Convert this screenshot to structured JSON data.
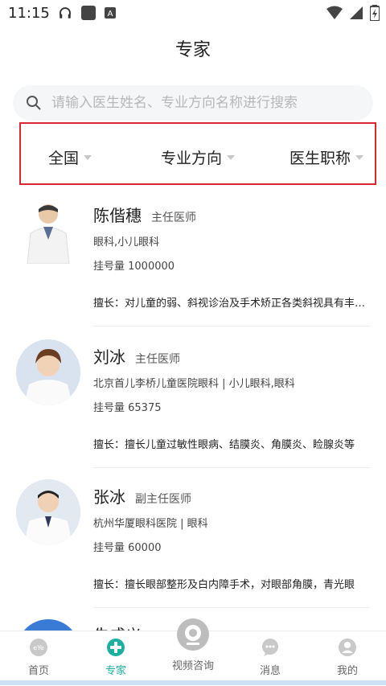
{
  "status_bar": {
    "time": "11:15",
    "icons_left": [
      "headphones-icon",
      "app-square-icon",
      "a-icon"
    ],
    "icons_right": [
      "wifi-icon",
      "signal-icon",
      "battery-icon"
    ]
  },
  "header": {
    "title": "专家"
  },
  "search": {
    "placeholder": "请输入医生姓名、专业方向名称进行搜索"
  },
  "filters": [
    {
      "label": "全国"
    },
    {
      "label": "专业方向"
    },
    {
      "label": "医生职称"
    }
  ],
  "doctors": [
    {
      "name": "陈偕穗",
      "title": "主任医师",
      "dept": "眼科,小儿眼科",
      "reg": "挂号量 1000000",
      "spec": "擅长：对儿童的弱、斜视诊治及手术矫正各类斜视具有丰富经验"
    },
    {
      "name": "刘冰",
      "title": "主任医师",
      "dept": "北京首儿李桥儿童医院眼科 | 小儿眼科,眼科",
      "reg": "挂号量 65375",
      "spec": "擅长：擅长儿童过敏性眼病、结膜炎、角膜炎、睑腺炎等"
    },
    {
      "name": "张冰",
      "title": "副主任医师",
      "dept": "杭州华厦眼科医院 | 眼科",
      "reg": "挂号量 60000",
      "spec": "擅长：擅长眼部整形及白内障手术，对眼部角膜，青光眼"
    },
    {
      "name": "朱成义",
      "title": "副主",
      "dept": "",
      "reg": "",
      "spec": ""
    }
  ],
  "tabbar": {
    "tabs": [
      {
        "label": "首页",
        "icon": "home-eye-icon"
      },
      {
        "label": "专家",
        "icon": "expert-plus-icon"
      },
      {
        "label": "视频咨询",
        "icon": "video-camera-icon"
      },
      {
        "label": "消息",
        "icon": "message-icon"
      },
      {
        "label": "我的",
        "icon": "profile-icon"
      }
    ],
    "active": "专家",
    "accent_color": "#1ab0a0"
  }
}
